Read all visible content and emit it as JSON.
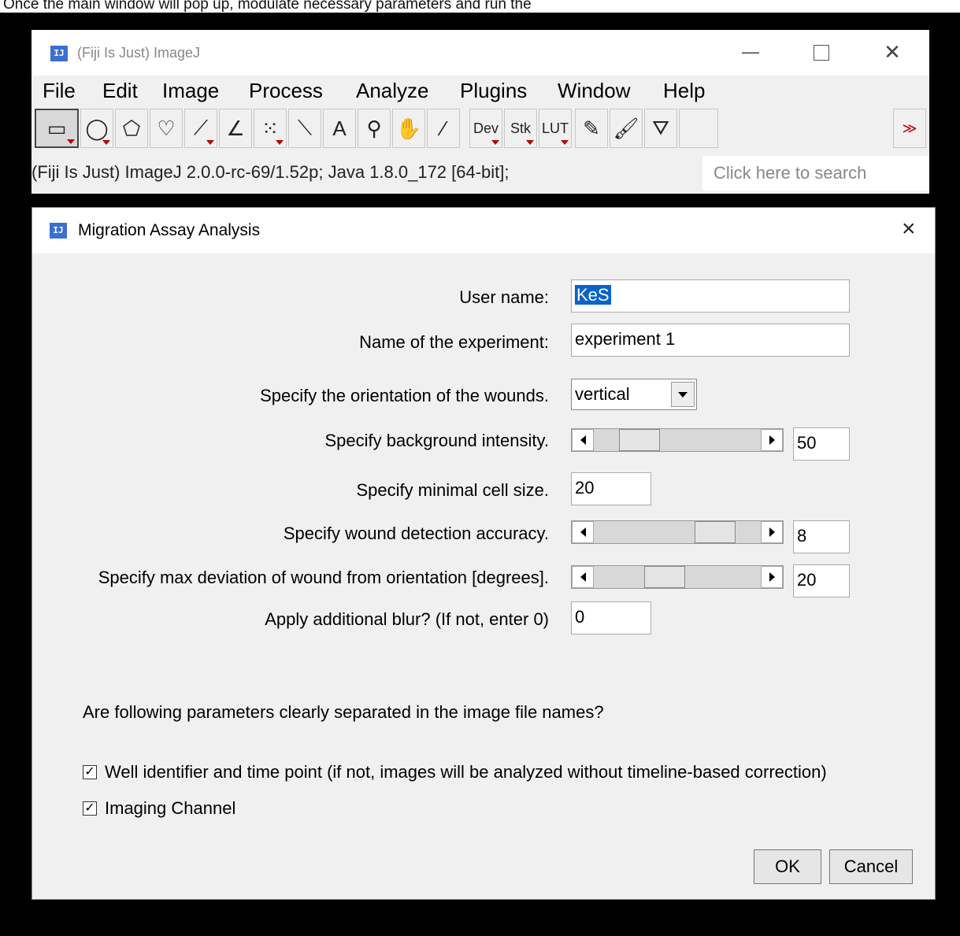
{
  "caption": "Once the main window will pop up, modulate necessary parameters and run the",
  "imagej": {
    "title": "(Fiji Is Just) ImageJ",
    "menu": [
      "File",
      "Edit",
      "Image",
      "Process",
      "Analyze",
      "Plugins",
      "Window",
      "Help"
    ],
    "tools": [
      {
        "name": "rectangle-tool",
        "glyph": "▭"
      },
      {
        "name": "oval-tool",
        "glyph": "◯"
      },
      {
        "name": "polygon-tool",
        "glyph": "⬠"
      },
      {
        "name": "freehand-tool",
        "glyph": "♡"
      },
      {
        "name": "line-tool",
        "glyph": "⟋"
      },
      {
        "name": "angle-tool",
        "glyph": "∠"
      },
      {
        "name": "point-tool",
        "glyph": "⁙"
      },
      {
        "name": "wand-tool",
        "glyph": "⟍"
      },
      {
        "name": "text-tool",
        "glyph": "A"
      },
      {
        "name": "magnifier-tool",
        "glyph": "⚲"
      },
      {
        "name": "hand-tool",
        "glyph": "✋"
      },
      {
        "name": "color-picker-tool",
        "glyph": "⁄"
      }
    ],
    "tools_right": [
      {
        "name": "dev-button",
        "label": "Dev"
      },
      {
        "name": "stk-button",
        "label": "Stk"
      },
      {
        "name": "lut-button",
        "label": "LUT"
      }
    ],
    "tools_extra": [
      {
        "name": "pencil-tool",
        "glyph": "✎"
      },
      {
        "name": "brush-tool",
        "glyph": "🖌"
      },
      {
        "name": "flood-fill-tool",
        "glyph": "⛛"
      }
    ],
    "more_label": "≫",
    "status": "(Fiji Is Just) ImageJ 2.0.0-rc-69/1.52p; Java 1.8.0_172 [64-bit];",
    "search_placeholder": "Click here to search",
    "logo": "IJ"
  },
  "dialog": {
    "title": "Migration Assay Analysis",
    "close": "×",
    "logo": "IJ",
    "fields": {
      "user_name_label": "User name:",
      "user_name_value": "KeS",
      "experiment_label": "Name of the experiment:",
      "experiment_value": "experiment 1",
      "orientation_label": "Specify the orientation of the wounds.",
      "orientation_value": "vertical",
      "background_label": "Specify background intensity.",
      "background_value": "50",
      "background_level": 0.2,
      "cellsize_label": "Specify minimal cell size.",
      "cellsize_value": "20",
      "accuracy_label": "Specify wound detection accuracy.",
      "accuracy_value": "8",
      "accuracy_level": 0.8,
      "deviation_label": "Specify max deviation of wound from orientation [degrees].",
      "deviation_value": "20",
      "deviation_level": 0.4,
      "blur_label": "Apply additional blur? (If not, enter 0)",
      "blur_value": "0"
    },
    "question": "Are following parameters clearly separated in the image file names?",
    "checkboxes": [
      {
        "label": "Well identifier and time point (if not, images will be analyzed without timeline-based correction)",
        "checked": true
      },
      {
        "label": "Imaging Channel",
        "checked": true
      }
    ],
    "ok": "OK",
    "cancel": "Cancel"
  }
}
